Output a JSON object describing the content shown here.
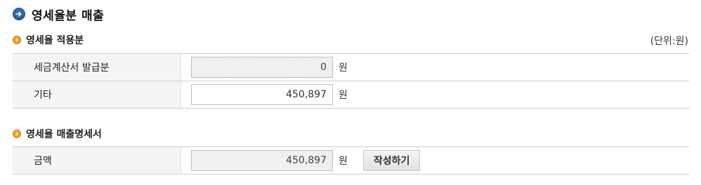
{
  "section": {
    "title": "영세율분 매출"
  },
  "applied": {
    "heading": "영세율 적용분",
    "unit_note": "(단위:원)",
    "rows": [
      {
        "label": "세금계산서 발급분",
        "value": "0",
        "currency": "원"
      },
      {
        "label": "기타",
        "value": "450,897",
        "currency": "원"
      }
    ]
  },
  "statement": {
    "heading": "영세율 매출명세서",
    "row": {
      "label": "금액",
      "value": "450,897",
      "currency": "원",
      "button_label": "작성하기"
    }
  },
  "colors": {
    "title_icon": "#2f6fb0",
    "sub_icon": "#f0a020",
    "label_bg": "#f5f5f5",
    "border": "#cfcfcf"
  }
}
